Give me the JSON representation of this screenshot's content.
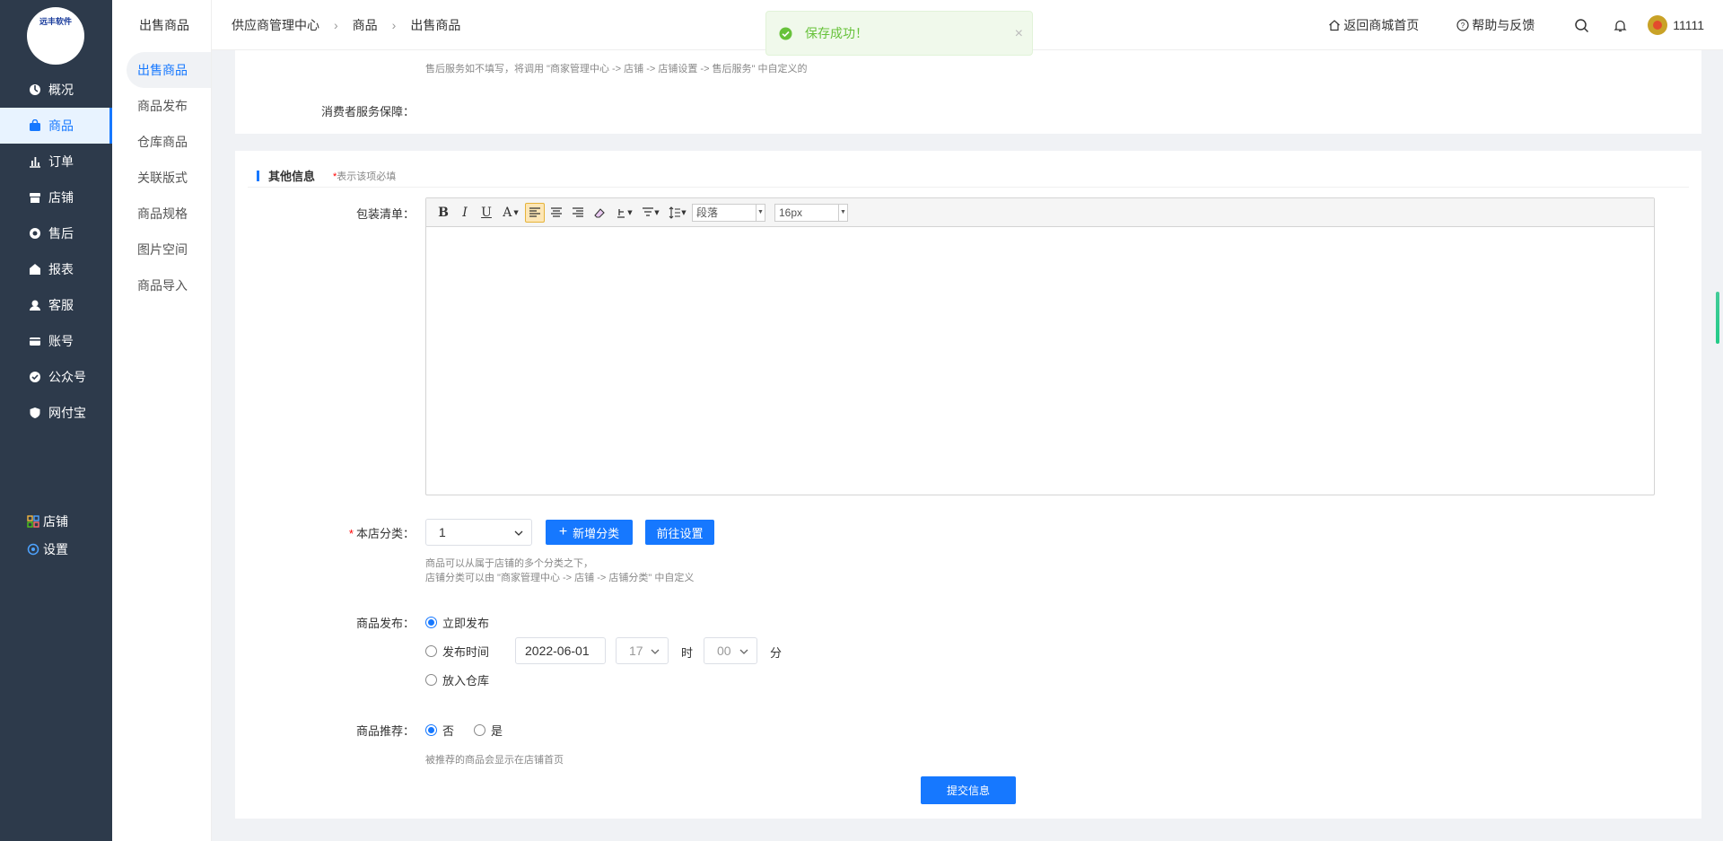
{
  "logo": {
    "text": "远丰软件"
  },
  "nav": {
    "items": [
      {
        "label": "概况",
        "icon": "dashboard-icon"
      },
      {
        "label": "商品",
        "icon": "bag-icon",
        "active": true
      },
      {
        "label": "订单",
        "icon": "chart-icon"
      },
      {
        "label": "店铺",
        "icon": "store-icon"
      },
      {
        "label": "售后",
        "icon": "aftersale-icon"
      },
      {
        "label": "报表",
        "icon": "report-icon"
      },
      {
        "label": "客服",
        "icon": "service-icon"
      },
      {
        "label": "账号",
        "icon": "account-icon"
      },
      {
        "label": "公众号",
        "icon": "wechat-icon"
      },
      {
        "label": "网付宝",
        "icon": "shield-icon"
      }
    ],
    "bottom": [
      {
        "label": "店铺",
        "icon": "grid-icon"
      },
      {
        "label": "设置",
        "icon": "gear-icon"
      }
    ]
  },
  "subnav": {
    "title": "出售商品",
    "items": [
      "出售商品",
      "商品发布",
      "仓库商品",
      "关联版式",
      "商品规格",
      "图片空间",
      "商品导入"
    ]
  },
  "breadcrumb": [
    "供应商管理中心",
    "商品",
    "出售商品"
  ],
  "topbar": {
    "home": "返回商城首页",
    "help": "帮助与反馈",
    "user": "11111"
  },
  "toast": {
    "message": "保存成功！",
    "close": "×"
  },
  "section1": {
    "hint": "售后服务如不填写，将调用 \"商家管理中心 -> 店铺 -> 店铺设置 -> 售后服务\" 中自定义的",
    "guarantee_label": "消费者服务保障："
  },
  "section2": {
    "title": "其他信息",
    "note_star": "*",
    "note": "表示该项必填",
    "packing_label": "包装清单：",
    "editor": {
      "paragraph": "段落",
      "fontsize": "16px",
      "bold": "B",
      "italic": "I",
      "underline": "U",
      "fontcolor": "A"
    },
    "category_star": "*",
    "category_label": "本店分类：",
    "category_value": "1",
    "add_category": "新增分类",
    "go_settings": "前往设置",
    "category_hint1": "商品可以从属于店铺的多个分类之下，",
    "category_hint2": "店铺分类可以由 \"商家管理中心 -> 店铺 -> 店铺分类\" 中自定义",
    "publish_label": "商品发布：",
    "publish_now": "立即发布",
    "publish_time": "发布时间",
    "publish_date": "2022-06-01",
    "publish_hour": "17",
    "hour_unit": "时",
    "publish_minute": "00",
    "minute_unit": "分",
    "to_warehouse": "放入仓库",
    "recommend_label": "商品推荐：",
    "recommend_no": "否",
    "recommend_yes": "是",
    "recommend_hint": "被推荐的商品会显示在店铺首页",
    "submit": "提交信息"
  }
}
